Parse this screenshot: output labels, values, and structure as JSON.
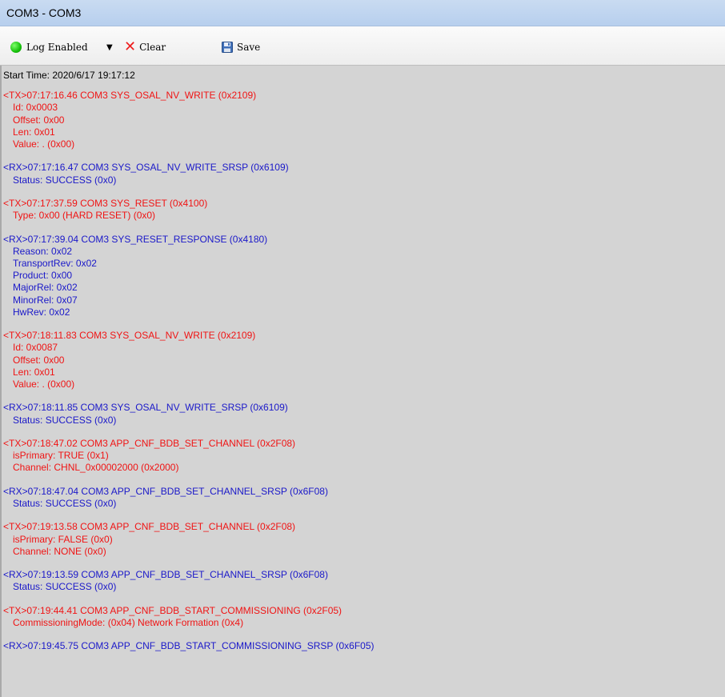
{
  "window": {
    "title": "COM3 - COM3"
  },
  "toolbar": {
    "log_label": "Log Enabled",
    "dropdown_arrow": "▼",
    "clear_label": "Clear",
    "save_label": "Save"
  },
  "colors": {
    "tx": "#f01414",
    "rx": "#1a18c9",
    "background": "#d4d4d4"
  },
  "log": {
    "start_time": "Start Time: 2020/6/17 19:17:12",
    "entries": [
      {
        "direction": "TX",
        "header": "<TX>07:17:16.46 COM3 SYS_OSAL_NV_WRITE (0x2109)",
        "lines": [
          "Id: 0x0003",
          "Offset: 0x00",
          "Len: 0x01",
          "Value: . (0x00)"
        ]
      },
      {
        "direction": "RX",
        "header": "<RX>07:17:16.47 COM3 SYS_OSAL_NV_WRITE_SRSP (0x6109)",
        "lines": [
          "Status: SUCCESS (0x0)"
        ]
      },
      {
        "direction": "TX",
        "header": "<TX>07:17:37.59 COM3 SYS_RESET (0x4100)",
        "lines": [
          "Type: 0x00 (HARD RESET) (0x0)"
        ]
      },
      {
        "direction": "RX",
        "header": "<RX>07:17:39.04 COM3 SYS_RESET_RESPONSE (0x4180)",
        "lines": [
          "Reason: 0x02",
          "TransportRev: 0x02",
          "Product: 0x00",
          "MajorRel: 0x02",
          "MinorRel: 0x07",
          "HwRev: 0x02"
        ]
      },
      {
        "direction": "TX",
        "header": "<TX>07:18:11.83 COM3 SYS_OSAL_NV_WRITE (0x2109)",
        "lines": [
          "Id: 0x0087",
          "Offset: 0x00",
          "Len: 0x01",
          "Value: . (0x00)"
        ]
      },
      {
        "direction": "RX",
        "header": "<RX>07:18:11.85 COM3 SYS_OSAL_NV_WRITE_SRSP (0x6109)",
        "lines": [
          "Status: SUCCESS (0x0)"
        ]
      },
      {
        "direction": "TX",
        "header": "<TX>07:18:47.02 COM3 APP_CNF_BDB_SET_CHANNEL (0x2F08)",
        "lines": [
          "isPrimary: TRUE (0x1)",
          "Channel: CHNL_0x00002000 (0x2000)"
        ]
      },
      {
        "direction": "RX",
        "header": "<RX>07:18:47.04 COM3 APP_CNF_BDB_SET_CHANNEL_SRSP (0x6F08)",
        "lines": [
          "Status: SUCCESS (0x0)"
        ]
      },
      {
        "direction": "TX",
        "header": "<TX>07:19:13.58 COM3 APP_CNF_BDB_SET_CHANNEL (0x2F08)",
        "lines": [
          "isPrimary: FALSE (0x0)",
          "Channel: NONE (0x0)"
        ]
      },
      {
        "direction": "RX",
        "header": "<RX>07:19:13.59 COM3 APP_CNF_BDB_SET_CHANNEL_SRSP (0x6F08)",
        "lines": [
          "Status: SUCCESS (0x0)"
        ]
      },
      {
        "direction": "TX",
        "header": "<TX>07:19:44.41 COM3 APP_CNF_BDB_START_COMMISSIONING (0x2F05)",
        "lines": [
          "CommissioningMode: (0x04) Network Formation (0x4)"
        ]
      },
      {
        "direction": "RX",
        "header": "<RX>07:19:45.75 COM3 APP_CNF_BDB_START_COMMISSIONING_SRSP (0x6F05)",
        "lines": []
      }
    ]
  }
}
